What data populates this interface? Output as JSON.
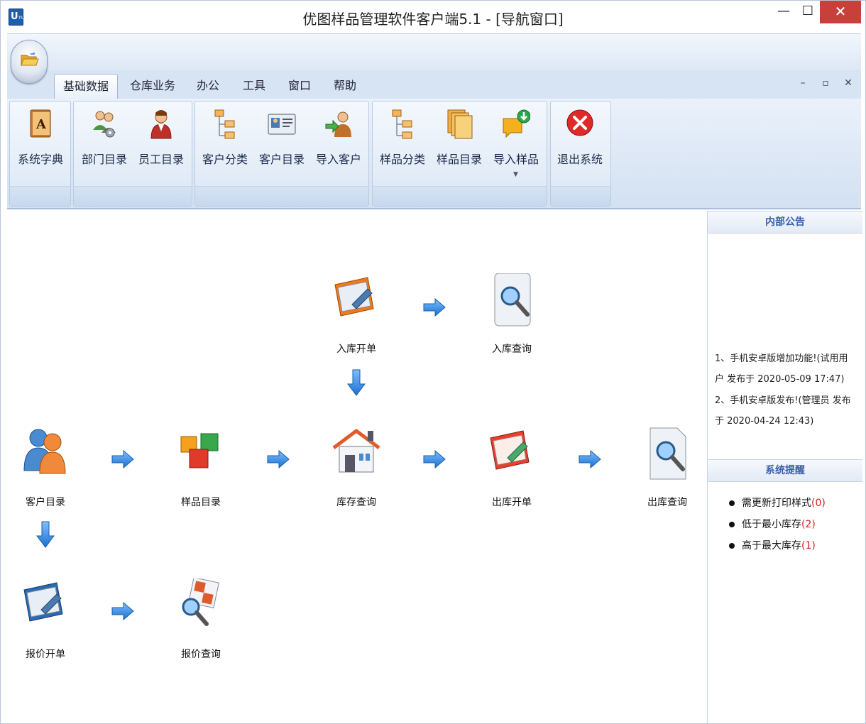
{
  "window": {
    "title": "优图样品管理软件客户端5.1 - [导航窗口]",
    "logo_text": "U",
    "minimize_glyph": "—",
    "maximize_glyph": "☐",
    "close_glyph": "✕"
  },
  "ribbon": {
    "tabs": [
      {
        "label": "基础数据",
        "active": true
      },
      {
        "label": "仓库业务"
      },
      {
        "label": "办公"
      },
      {
        "label": "工具"
      },
      {
        "label": "窗口"
      },
      {
        "label": "帮助"
      }
    ],
    "mdi_buttons": [
      "–",
      "▫",
      "✕"
    ],
    "buttons": [
      {
        "label": "系统字典",
        "icon": "dictionary-book-icon"
      },
      {
        "label": "部门目录",
        "icon": "department-users-icon"
      },
      {
        "label": "员工目录",
        "icon": "employee-icon"
      },
      {
        "label": "客户分类",
        "icon": "tree-category-icon"
      },
      {
        "label": "客户目录",
        "icon": "contact-card-icon"
      },
      {
        "label": "导入客户",
        "icon": "import-user-icon"
      },
      {
        "label": "样品分类",
        "icon": "tree-category-icon"
      },
      {
        "label": "样品目录",
        "icon": "stacked-docs-icon"
      },
      {
        "label": "导入样品",
        "icon": "import-sample-icon",
        "has_dropdown": true
      },
      {
        "label": "退出系统",
        "icon": "exit-icon"
      }
    ]
  },
  "flow": {
    "nodes": {
      "inbound_order": "入库开单",
      "inbound_query": "入库查询",
      "customer_dir": "客户目录",
      "sample_dir": "样品目录",
      "stock_query": "库存查询",
      "outbound_order": "出库开单",
      "outbound_query": "出库查询",
      "quote_order": "报价开单",
      "quote_query": "报价查询"
    }
  },
  "panel": {
    "notice_title": "内部公告",
    "notices": [
      "1、手机安卓版增加功能!(试用用户 发布于 2020-05-09 17:47)",
      "2、手机安卓版发布!(管理员 发布于 2020-04-24 12:43)"
    ],
    "remind_title": "系统提醒",
    "reminders": [
      {
        "label": "需更新打印样式",
        "count": "(0)"
      },
      {
        "label": "低于最小库存",
        "count": "(2)"
      },
      {
        "label": "高于最大库存",
        "count": "(1)"
      }
    ]
  },
  "colors": {
    "accent_blue": "#2a78d6",
    "ribbon_bg": "#d7e4f4",
    "close_red": "#c7403a",
    "count_red": "#d02020"
  }
}
